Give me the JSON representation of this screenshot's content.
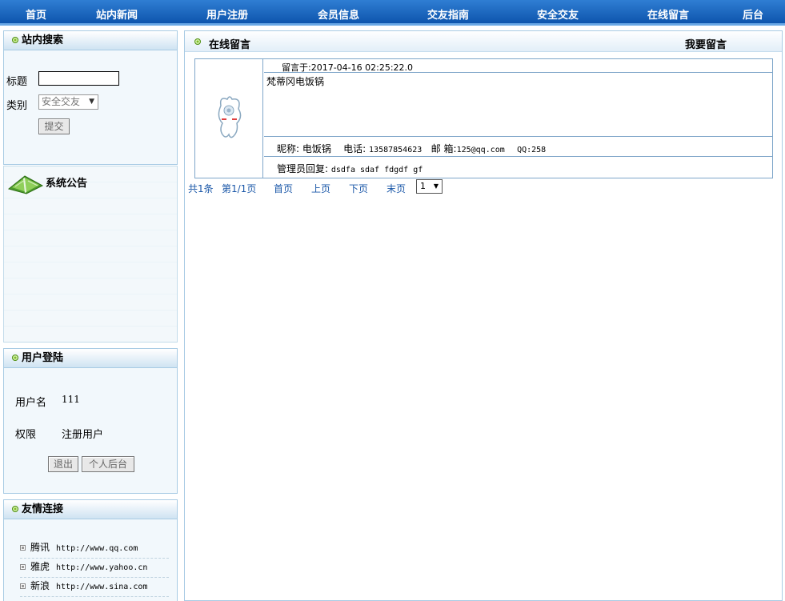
{
  "nav": {
    "items": [
      "首页",
      "站内新闻",
      "用户注册",
      "会员信息",
      "交友指南",
      "安全交友",
      "在线留言",
      "后台"
    ]
  },
  "search": {
    "title": "站内搜索",
    "title_label": "标题",
    "title_value": "",
    "category_label": "类别",
    "category_selected": "安全交友",
    "submit_label": "提交"
  },
  "notice": {
    "title": "系统公告"
  },
  "login": {
    "title": "用户登陆",
    "username_label": "用户名",
    "username_value": "111",
    "role_label": "权限",
    "role_value": "注册用户",
    "logout_label": "退出",
    "personal_label": "个人后台"
  },
  "links": {
    "title": "友情连接",
    "items": [
      {
        "name": "腾讯",
        "url": "http://www.qq.com"
      },
      {
        "name": "雅虎",
        "url": "http://www.yahoo.cn"
      },
      {
        "name": "新浪",
        "url": "http://www.sina.com"
      }
    ]
  },
  "main": {
    "title": "在线留言",
    "action": "我要留言",
    "message": {
      "posted": "留言于:2017-04-16 02:25:22.0",
      "content": "梵蒂冈电饭锅",
      "nick_label": "昵称:",
      "nick_value": "电饭锅",
      "phone_label": "电话:",
      "phone_value": "13587854623",
      "email_label": "邮 箱:",
      "email_value": "125@qq.com",
      "qq_label": "QQ:",
      "qq_value": "258",
      "reply_label": "管理员回复:",
      "reply_value": "dsdfa sdaf fdgdf gf"
    },
    "pager": {
      "total": "共1条",
      "page": "第1/1页",
      "first": "首页",
      "prev": "上页",
      "next": "下页",
      "last": "末页",
      "selected_page": "1"
    }
  },
  "colors": {
    "nav_bg": "#1a63bf",
    "border": "#a8cbe4",
    "link": "#1a57a8"
  }
}
